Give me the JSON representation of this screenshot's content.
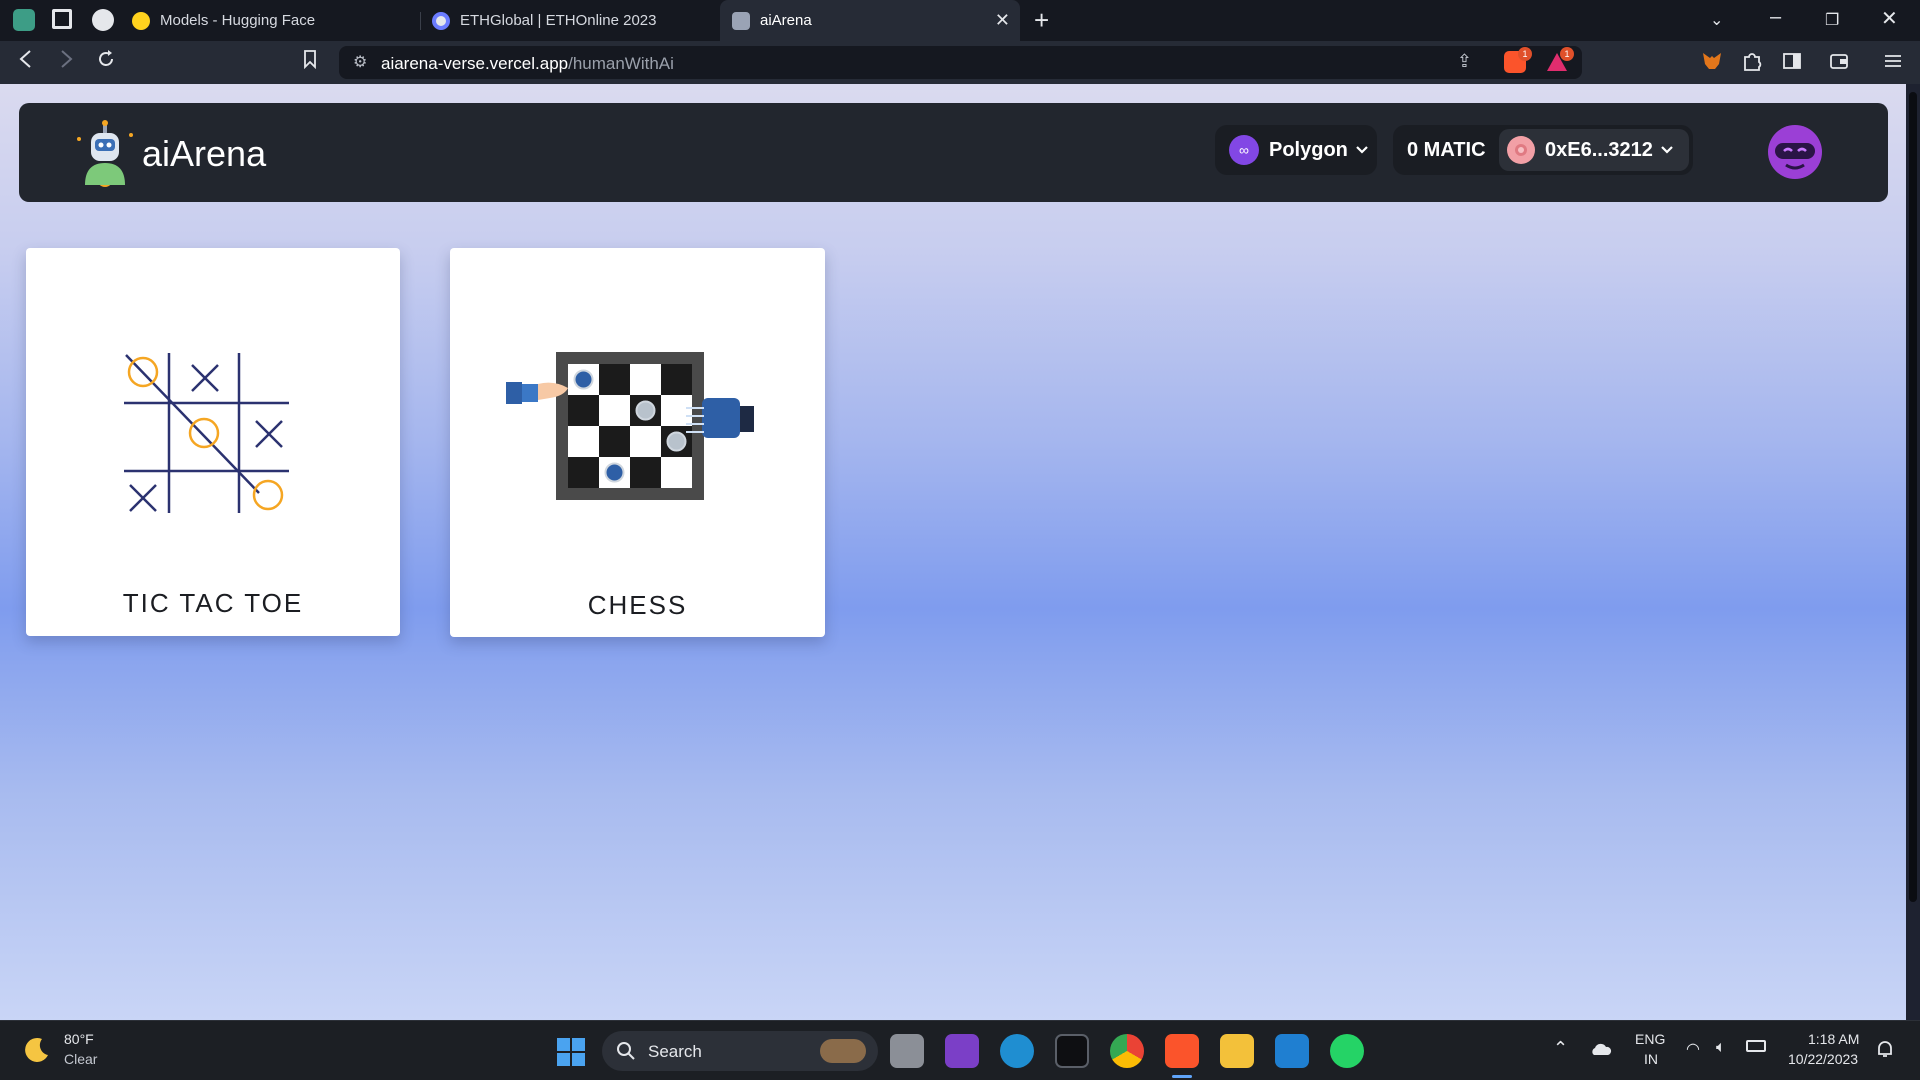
{
  "browser": {
    "tabs": [
      {
        "title": "Models - Hugging Face"
      },
      {
        "title": "ETHGlobal | ETHOnline 2023"
      },
      {
        "title": "aiArena"
      }
    ],
    "address": {
      "domain": "aiarena-verse.vercel.app",
      "path": "/humanWithAi"
    },
    "brave_shield_count": "1",
    "rewards_count": "1"
  },
  "app": {
    "brand": "aiArena",
    "network": {
      "name": "Polygon"
    },
    "account": {
      "balance": "0 MATIC",
      "address": "0xE6...3212"
    }
  },
  "games": [
    {
      "title": "TIC TAC TOE",
      "icon": "tic-tac-toe-illustration"
    },
    {
      "title": "CHESS",
      "icon": "chess-board-illustration"
    }
  ],
  "taskbar": {
    "weather": {
      "temp": "80°F",
      "desc": "Clear"
    },
    "search_label": "Search",
    "lang": "ENG",
    "region": "IN",
    "time": "1:18 AM",
    "date": "10/22/2023"
  },
  "colors": {
    "brand_purple": "#8247e5",
    "navbar_bg": "#22262e",
    "accent_orange": "#f5a623"
  }
}
